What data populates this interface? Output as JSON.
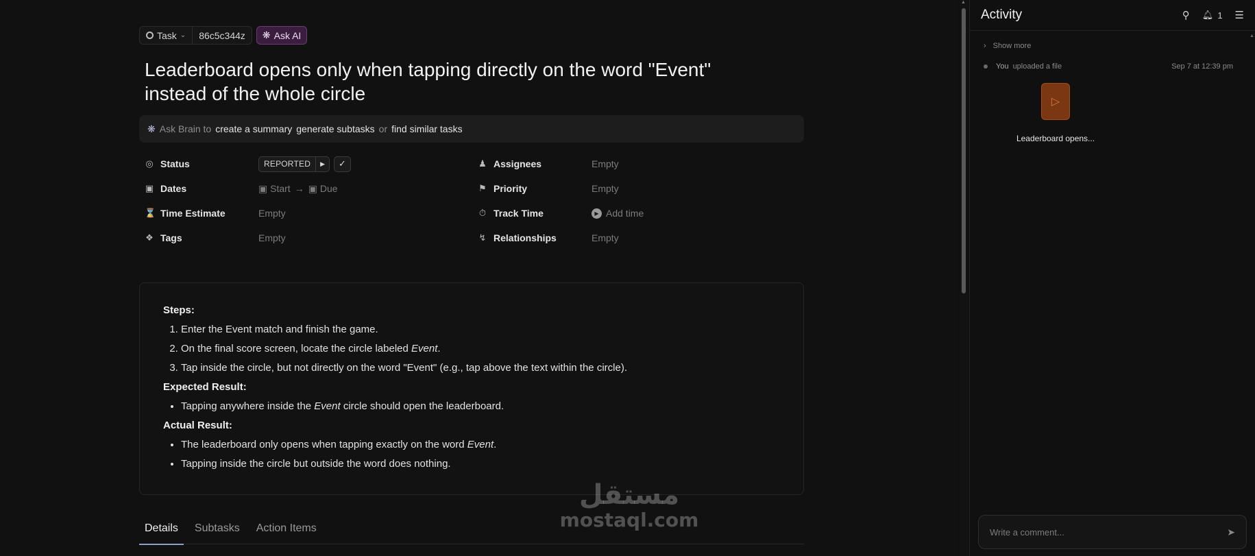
{
  "topbar": {
    "task_type": "Task",
    "task_id": "86c5c344z",
    "ask_ai": "Ask AI"
  },
  "title": "Leaderboard opens only when tapping directly on the word \"Event\" instead of the whole circle",
  "brain_bar": {
    "prefix": "Ask Brain to",
    "link1": "create a summary",
    "link2": "generate subtasks",
    "sep": "or",
    "link3": "find similar tasks"
  },
  "properties": {
    "status": {
      "label": "Status",
      "value": "REPORTED"
    },
    "assignees": {
      "label": "Assignees",
      "value": "Empty"
    },
    "dates": {
      "label": "Dates",
      "start": "Start",
      "due": "Due"
    },
    "priority": {
      "label": "Priority",
      "value": "Empty"
    },
    "time_estimate": {
      "label": "Time Estimate",
      "value": "Empty"
    },
    "track_time": {
      "label": "Track Time",
      "value": "Add time"
    },
    "tags": {
      "label": "Tags",
      "value": "Empty"
    },
    "relationships": {
      "label": "Relationships",
      "value": "Empty"
    }
  },
  "description": {
    "steps_heading": "Steps:",
    "steps": [
      "Enter the Event match and finish the game.",
      "On the final score screen, locate the circle labeled ",
      "Tap inside the circle, but not directly on the word \"Event\" (e.g., tap above the text within the circle)."
    ],
    "step2_em": "Event",
    "step2_tail": ".",
    "expected_heading": "Expected Result:",
    "expected_pre": "Tapping anywhere inside the ",
    "expected_em": "Event",
    "expected_post": " circle should open the leaderboard.",
    "actual_heading": "Actual Result:",
    "actual1_pre": "The leaderboard only opens when tapping exactly on the word ",
    "actual1_em": "Event",
    "actual1_post": ".",
    "actual2": "Tapping inside the circle but outside the word does nothing."
  },
  "tabs": [
    "Details",
    "Subtasks",
    "Action Items"
  ],
  "activity": {
    "title": "Activity",
    "notification_count": "1",
    "show_more": "Show more",
    "upload_actor": "You",
    "upload_text": "uploaded a file",
    "upload_time": "Sep 7 at 12:39 pm",
    "file_name": "Leaderboard opens...",
    "comment_placeholder": "Write a comment..."
  },
  "watermark": {
    "arabic": "مستقل",
    "latin": "mostaql.com"
  },
  "colors": {
    "accent_ai": "#3a1d3f",
    "file_icon": "#7a3712",
    "tab_underline": "#8fa0c8"
  }
}
